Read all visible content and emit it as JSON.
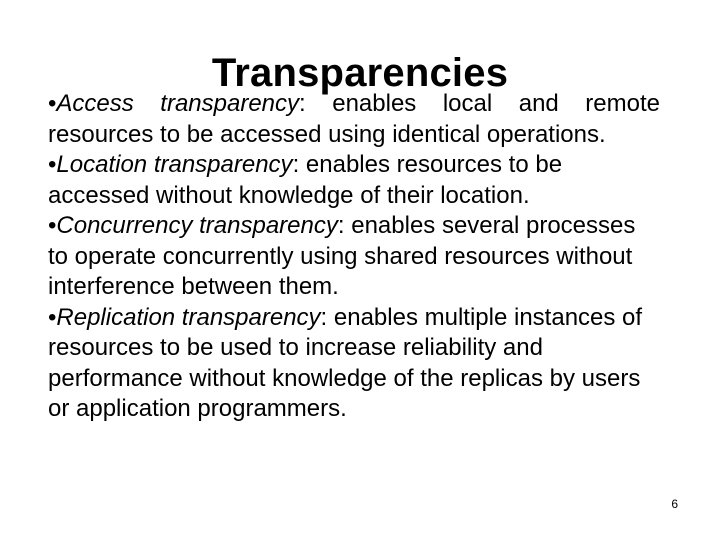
{
  "slide": {
    "title": "Transparencies",
    "page_number": "6",
    "bullet_marker": "•",
    "bullets": [
      {
        "term": "Access transparency",
        "separator": ":",
        "description": " enables local and remote resources to be accessed using identical operations."
      },
      {
        "term": "Location transparency",
        "separator": ":",
        "description": " enables resources to be accessed without knowledge of their location."
      },
      {
        "term": "Concurrency transparency",
        "separator": ":",
        "description": " enables several processes to operate concurrently using shared resources without interference between them."
      },
      {
        "term": "Replication transparency",
        "separator": ":",
        "description": " enables multiple instances of resources to be used to increase reliability and performance without knowledge of the replicas by users or application programmers."
      }
    ]
  }
}
